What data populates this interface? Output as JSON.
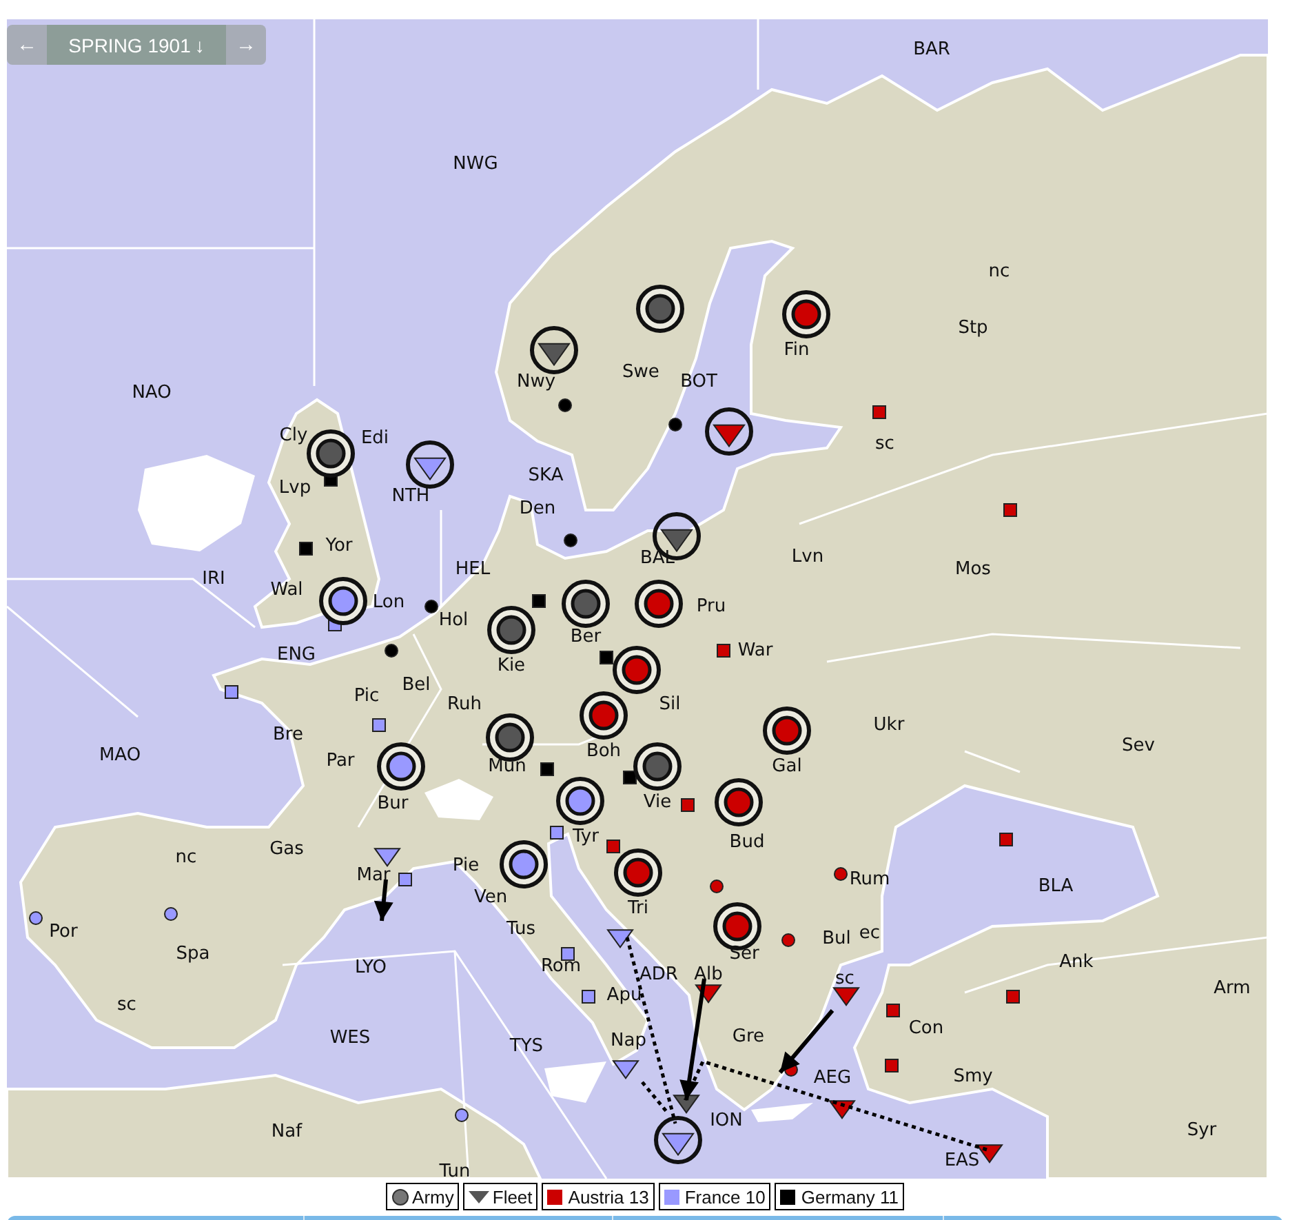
{
  "phase_nav": {
    "prev": "←",
    "label": "SPRING 1901",
    "direction_icon": "↓",
    "next": "→"
  },
  "map": {
    "labels": [
      "BAR",
      "NWG",
      "NAO",
      "nc",
      "Stp",
      "Fin",
      "Swe",
      "Nwy",
      "BOT",
      "Cly",
      "Edi",
      "sc",
      "Lvp",
      "NTH",
      "SKA",
      "Den",
      "Yor",
      "IRI",
      "HEL",
      "BAL",
      "Lvn",
      "Mos",
      "Wal",
      "Lon",
      "Kie",
      "Ber",
      "Hol",
      "Pru",
      "ENG",
      "War",
      "Bel",
      "Pic",
      "Ruh",
      "Sil",
      "Bre",
      "MAO",
      "Par",
      "Bur",
      "Mun",
      "Boh",
      "Gal",
      "Ukr",
      "Sev",
      "Vie",
      "Tyr",
      "Bud",
      "Gas",
      "nc",
      "Mar",
      "Pie",
      "Ven",
      "Tus",
      "Tri",
      "Rum",
      "BLA",
      "Por",
      "Spa",
      "LYO",
      "Rom",
      "ADR",
      "Alb",
      "Ser",
      "Bul",
      "ec",
      "Ank",
      "Arm",
      "sc",
      "Apu",
      "sc",
      "Con",
      "WES",
      "TYS",
      "Nap",
      "Gre",
      "AEG",
      "Smy",
      "ION",
      "Naf",
      "Tun",
      "Syr",
      "EAS"
    ],
    "supply_centers": [
      {
        "kind": "square",
        "color": "#000000"
      },
      {
        "kind": "square",
        "color": "#000000"
      },
      {
        "kind": "square",
        "color": "#000000"
      },
      {
        "kind": "square",
        "color": "#000000"
      },
      {
        "kind": "square",
        "color": "#000000"
      },
      {
        "kind": "square",
        "color": "#000000"
      },
      {
        "kind": "square",
        "color": "#cc0000"
      },
      {
        "kind": "square",
        "color": "#cc0000"
      },
      {
        "kind": "square",
        "color": "#cc0000"
      },
      {
        "kind": "square",
        "color": "#cc0000"
      },
      {
        "kind": "square",
        "color": "#cc0000"
      },
      {
        "kind": "square",
        "color": "#cc0000"
      },
      {
        "kind": "square",
        "color": "#cc0000"
      },
      {
        "kind": "square",
        "color": "#cc0000"
      },
      {
        "kind": "square",
        "color": "#cc0000"
      },
      {
        "kind": "square",
        "color": "#9999ff"
      },
      {
        "kind": "square",
        "color": "#9999ff"
      },
      {
        "kind": "square",
        "color": "#9999ff"
      },
      {
        "kind": "square",
        "color": "#9999ff"
      },
      {
        "kind": "square",
        "color": "#9999ff"
      },
      {
        "kind": "square",
        "color": "#9999ff"
      },
      {
        "kind": "square",
        "color": "#9999ff"
      },
      {
        "kind": "dot",
        "color": "#000000"
      },
      {
        "kind": "dot",
        "color": "#000000"
      },
      {
        "kind": "dot",
        "color": "#000000"
      },
      {
        "kind": "dot",
        "color": "#000000"
      },
      {
        "kind": "dot",
        "color": "#000000"
      },
      {
        "kind": "dot",
        "color": "#cc0000"
      },
      {
        "kind": "dot",
        "color": "#cc0000"
      },
      {
        "kind": "dot",
        "color": "#cc0000"
      },
      {
        "kind": "dot",
        "color": "#cc0000"
      },
      {
        "kind": "dot",
        "color": "#9999ff"
      },
      {
        "kind": "dot",
        "color": "#9999ff"
      },
      {
        "kind": "dot",
        "color": "#9999ff"
      }
    ],
    "units": [
      {
        "kind": "army",
        "color": "#cc0000",
        "ringed": true
      },
      {
        "kind": "fleet",
        "color": "#cc0000",
        "ringed": true
      },
      {
        "kind": "army",
        "color": "#555555",
        "ringed": true
      },
      {
        "kind": "fleet",
        "color": "#555555",
        "ringed": true
      },
      {
        "kind": "army",
        "color": "#555555",
        "ringed": true
      },
      {
        "kind": "fleet",
        "color": "#9999ff",
        "ringed": true
      },
      {
        "kind": "fleet",
        "color": "#555555",
        "ringed": true
      },
      {
        "kind": "army",
        "color": "#9999ff",
        "ringed": true
      },
      {
        "kind": "army",
        "color": "#555555",
        "ringed": true
      },
      {
        "kind": "army",
        "color": "#555555",
        "ringed": true
      },
      {
        "kind": "army",
        "color": "#cc0000",
        "ringed": true
      },
      {
        "kind": "army",
        "color": "#cc0000",
        "ringed": true
      },
      {
        "kind": "army",
        "color": "#cc0000",
        "ringed": true
      },
      {
        "kind": "army",
        "color": "#555555",
        "ringed": true
      },
      {
        "kind": "army",
        "color": "#cc0000",
        "ringed": true
      },
      {
        "kind": "army",
        "color": "#9999ff",
        "ringed": true
      },
      {
        "kind": "army",
        "color": "#555555",
        "ringed": true
      },
      {
        "kind": "army",
        "color": "#9999ff",
        "ringed": true
      },
      {
        "kind": "army",
        "color": "#cc0000",
        "ringed": true
      },
      {
        "kind": "army",
        "color": "#9999ff",
        "ringed": true
      },
      {
        "kind": "army",
        "color": "#cc0000",
        "ringed": true
      },
      {
        "kind": "army",
        "color": "#cc0000",
        "ringed": true
      },
      {
        "kind": "fleet",
        "color": "#9999ff",
        "ringed": false
      },
      {
        "kind": "fleet",
        "color": "#9999ff",
        "ringed": false
      },
      {
        "kind": "fleet",
        "color": "#cc0000",
        "ringed": false
      },
      {
        "kind": "fleet",
        "color": "#cc0000",
        "ringed": false
      },
      {
        "kind": "fleet",
        "color": "#9999ff",
        "ringed": false
      },
      {
        "kind": "fleet",
        "color": "#555555",
        "ringed": false
      },
      {
        "kind": "fleet",
        "color": "#9999ff",
        "ringed": true
      },
      {
        "kind": "fleet",
        "color": "#cc0000",
        "ringed": false
      },
      {
        "kind": "fleet",
        "color": "#cc0000",
        "ringed": false
      }
    ],
    "orders": [
      {
        "kind": "move"
      },
      {
        "kind": "move"
      },
      {
        "kind": "move"
      },
      {
        "kind": "support"
      },
      {
        "kind": "support"
      },
      {
        "kind": "support"
      }
    ]
  },
  "legend": [
    {
      "kind": "army",
      "label": "Army"
    },
    {
      "kind": "fleet",
      "label": "Fleet"
    },
    {
      "kind": "country",
      "label": "Austria 13",
      "color": "#cc0000"
    },
    {
      "kind": "country",
      "label": "France 10",
      "color": "#9999ff"
    },
    {
      "kind": "country",
      "label": "Germany 11",
      "color": "#000000"
    }
  ]
}
